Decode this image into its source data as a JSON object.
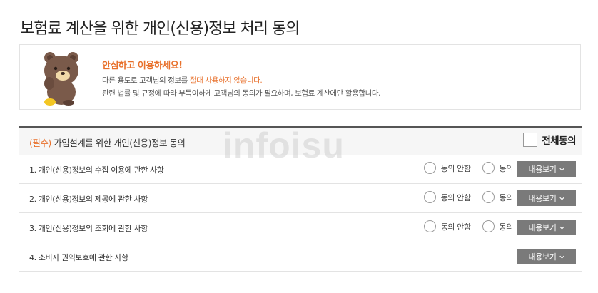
{
  "page": {
    "title": "보험료 계산을 위한 개인(신용)정보 처리 동의"
  },
  "notice": {
    "title": "안심하고 이용하세요!",
    "line1_pre": "다른 용도로 고객님의 정보를 ",
    "line1_highlight": "절대 사용하지 않습니다.",
    "line2": "관련 법률 및 규정에 따라 부득이하게 고객님의 동의가 필요하며, 보험료 계산에만 활용합니다.",
    "mascot_icon": "bear-mascot-icon",
    "accent_color": "#e8712c"
  },
  "consent": {
    "required_label": "(필수)",
    "header_title": "가입설계를 위한 개인(신용)정보 동의",
    "agree_all_label": "전체동의",
    "watermark": "infoisu",
    "rows": [
      {
        "label": "1. 개인(신용)정보의 수집 이용에 관한 사항",
        "disagree_label": "동의 안함",
        "agree_label": "동의",
        "view_label": "내용보기"
      },
      {
        "label": "2. 개인(신용)정보의 제공에 관한 사항",
        "disagree_label": "동의 안함",
        "agree_label": "동의",
        "view_label": "내용보기"
      },
      {
        "label": "3. 개인(신용)정보의 조회에 관한 사항",
        "disagree_label": "동의 안함",
        "agree_label": "동의",
        "view_label": "내용보기"
      },
      {
        "label": "4. 소비자 권익보호에 관한 사항",
        "view_label": "내용보기"
      }
    ]
  }
}
